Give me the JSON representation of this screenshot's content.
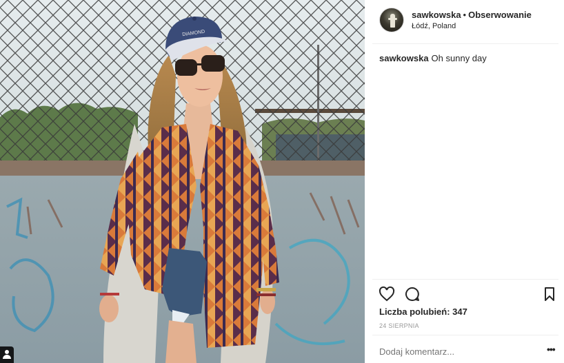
{
  "post": {
    "username": "sawkowska",
    "separator": "•",
    "follow_label": "Obserwowanie",
    "location": "Łódź, Poland",
    "caption_user": "sawkowska",
    "caption_text": "Oh sunny day",
    "likes_text": "Liczba polubień: 347",
    "date": "24 SIERPNIA",
    "comment_placeholder": "Dodaj komentarz...",
    "more_label": "•••",
    "photo_cap_text": "DIAMOND"
  },
  "icons": {
    "like": "heart-outline-icon",
    "comment": "speech-bubble-icon",
    "save": "bookmark-outline-icon",
    "tag": "user-tag-icon"
  },
  "colors": {
    "text": "#262626",
    "muted": "#999999",
    "divider": "#efefef"
  }
}
